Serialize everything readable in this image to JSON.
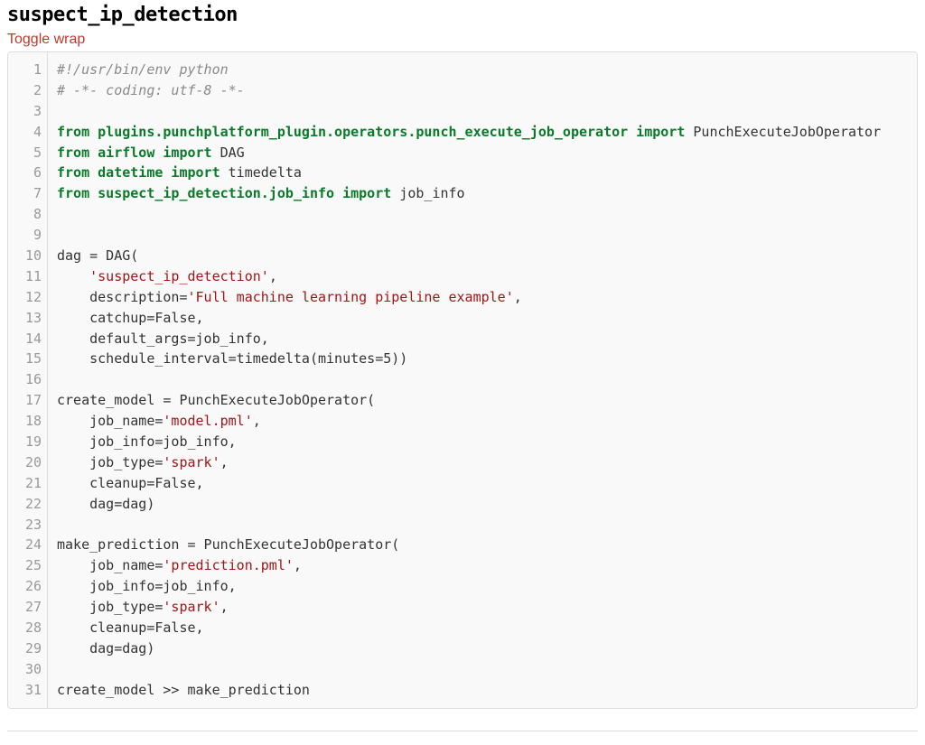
{
  "title": "suspect_ip_detection",
  "toggle_label": "Toggle wrap",
  "code": {
    "line_numbers": [
      "1",
      "2",
      "3",
      "4",
      "5",
      "6",
      "7",
      "8",
      "9",
      "10",
      "11",
      "12",
      "13",
      "14",
      "15",
      "16",
      "17",
      "18",
      "19",
      "20",
      "21",
      "22",
      "23",
      "24",
      "25",
      "26",
      "27",
      "28",
      "29",
      "30",
      "31"
    ],
    "lines": [
      [
        {
          "cls": "tok-comment",
          "t": "#!/usr/bin/env python"
        }
      ],
      [
        {
          "cls": "tok-comment",
          "t": "# -*- coding: utf-8 -*-"
        }
      ],
      [
        {
          "cls": "tok-normal",
          "t": ""
        }
      ],
      [
        {
          "cls": "tok-keyword",
          "t": "from "
        },
        {
          "cls": "tok-module",
          "t": "plugins.punchplatform_plugin.operators.punch_execute_job_operator"
        },
        {
          "cls": "tok-keyword",
          "t": " import "
        },
        {
          "cls": "tok-normal",
          "t": "PunchExecuteJobOperator"
        }
      ],
      [
        {
          "cls": "tok-keyword",
          "t": "from "
        },
        {
          "cls": "tok-module",
          "t": "airflow"
        },
        {
          "cls": "tok-keyword",
          "t": " import "
        },
        {
          "cls": "tok-normal",
          "t": "DAG"
        }
      ],
      [
        {
          "cls": "tok-keyword",
          "t": "from "
        },
        {
          "cls": "tok-module",
          "t": "datetime"
        },
        {
          "cls": "tok-keyword",
          "t": " import "
        },
        {
          "cls": "tok-normal",
          "t": "timedelta"
        }
      ],
      [
        {
          "cls": "tok-keyword",
          "t": "from "
        },
        {
          "cls": "tok-module",
          "t": "suspect_ip_detection.job_info"
        },
        {
          "cls": "tok-keyword",
          "t": " import "
        },
        {
          "cls": "tok-normal",
          "t": "job_info"
        }
      ],
      [
        {
          "cls": "tok-normal",
          "t": ""
        }
      ],
      [
        {
          "cls": "tok-normal",
          "t": ""
        }
      ],
      [
        {
          "cls": "tok-normal",
          "t": "dag = DAG("
        }
      ],
      [
        {
          "cls": "tok-normal",
          "t": "    "
        },
        {
          "cls": "tok-string",
          "t": "'suspect_ip_detection'"
        },
        {
          "cls": "tok-normal",
          "t": ","
        }
      ],
      [
        {
          "cls": "tok-normal",
          "t": "    description="
        },
        {
          "cls": "tok-string",
          "t": "'Full machine learning pipeline example'"
        },
        {
          "cls": "tok-normal",
          "t": ","
        }
      ],
      [
        {
          "cls": "tok-normal",
          "t": "    catchup=False,"
        }
      ],
      [
        {
          "cls": "tok-normal",
          "t": "    default_args=job_info,"
        }
      ],
      [
        {
          "cls": "tok-normal",
          "t": "    schedule_interval=timedelta(minutes=5))"
        }
      ],
      [
        {
          "cls": "tok-normal",
          "t": ""
        }
      ],
      [
        {
          "cls": "tok-normal",
          "t": "create_model = PunchExecuteJobOperator("
        }
      ],
      [
        {
          "cls": "tok-normal",
          "t": "    job_name="
        },
        {
          "cls": "tok-string",
          "t": "'model.pml'"
        },
        {
          "cls": "tok-normal",
          "t": ","
        }
      ],
      [
        {
          "cls": "tok-normal",
          "t": "    job_info=job_info,"
        }
      ],
      [
        {
          "cls": "tok-normal",
          "t": "    job_type="
        },
        {
          "cls": "tok-string",
          "t": "'spark'"
        },
        {
          "cls": "tok-normal",
          "t": ","
        }
      ],
      [
        {
          "cls": "tok-normal",
          "t": "    cleanup=False,"
        }
      ],
      [
        {
          "cls": "tok-normal",
          "t": "    dag=dag)"
        }
      ],
      [
        {
          "cls": "tok-normal",
          "t": ""
        }
      ],
      [
        {
          "cls": "tok-normal",
          "t": "make_prediction = PunchExecuteJobOperator("
        }
      ],
      [
        {
          "cls": "tok-normal",
          "t": "    job_name="
        },
        {
          "cls": "tok-string",
          "t": "'prediction.pml'"
        },
        {
          "cls": "tok-normal",
          "t": ","
        }
      ],
      [
        {
          "cls": "tok-normal",
          "t": "    job_info=job_info,"
        }
      ],
      [
        {
          "cls": "tok-normal",
          "t": "    job_type="
        },
        {
          "cls": "tok-string",
          "t": "'spark'"
        },
        {
          "cls": "tok-normal",
          "t": ","
        }
      ],
      [
        {
          "cls": "tok-normal",
          "t": "    cleanup=False,"
        }
      ],
      [
        {
          "cls": "tok-normal",
          "t": "    dag=dag)"
        }
      ],
      [
        {
          "cls": "tok-normal",
          "t": ""
        }
      ],
      [
        {
          "cls": "tok-normal",
          "t": "create_model >> make_prediction"
        }
      ]
    ]
  }
}
